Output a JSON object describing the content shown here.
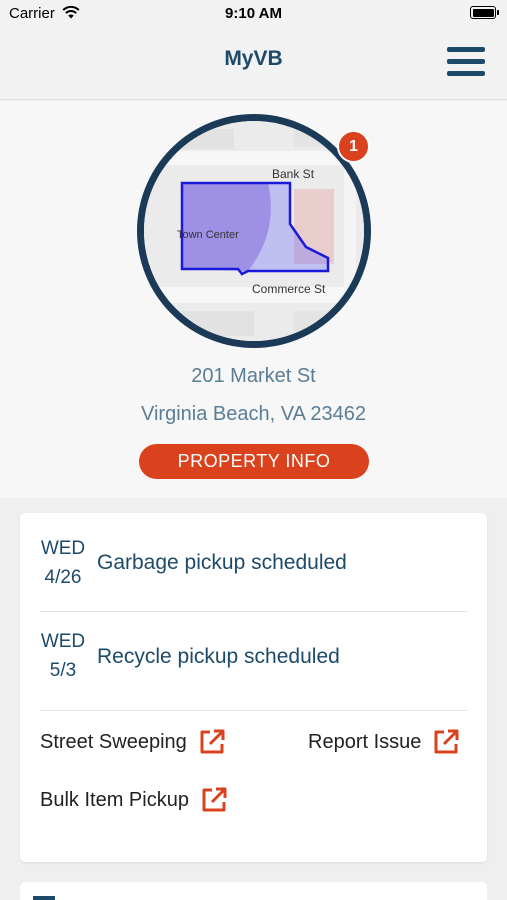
{
  "status_bar": {
    "carrier": "Carrier",
    "time": "9:10 AM"
  },
  "header": {
    "title": "MyVB",
    "menu_icon": "hamburger-menu-icon"
  },
  "property": {
    "map": {
      "street_top": "Bank St",
      "area_label": "Town Center",
      "street_bottom": "Commerce St",
      "outline_color": "#1a1adb"
    },
    "notification_count": "1",
    "address_line1": "201 Market St",
    "address_line2": "Virginia Beach, VA 23462",
    "info_button_label": "PROPERTY INFO"
  },
  "schedule": [
    {
      "day": "WED",
      "date": "4/26",
      "label": "Garbage pickup scheduled"
    },
    {
      "day": "WED",
      "date": "5/3",
      "label": "Recycle pickup scheduled"
    }
  ],
  "links": {
    "street_sweeping": "Street Sweeping",
    "report_issue": "Report Issue",
    "bulk_item_pickup": "Bulk Item Pickup",
    "icon": "external-link-icon"
  },
  "colors": {
    "accent": "#d9421c",
    "primary": "#1d4a68",
    "ring": "#1b3a57"
  }
}
